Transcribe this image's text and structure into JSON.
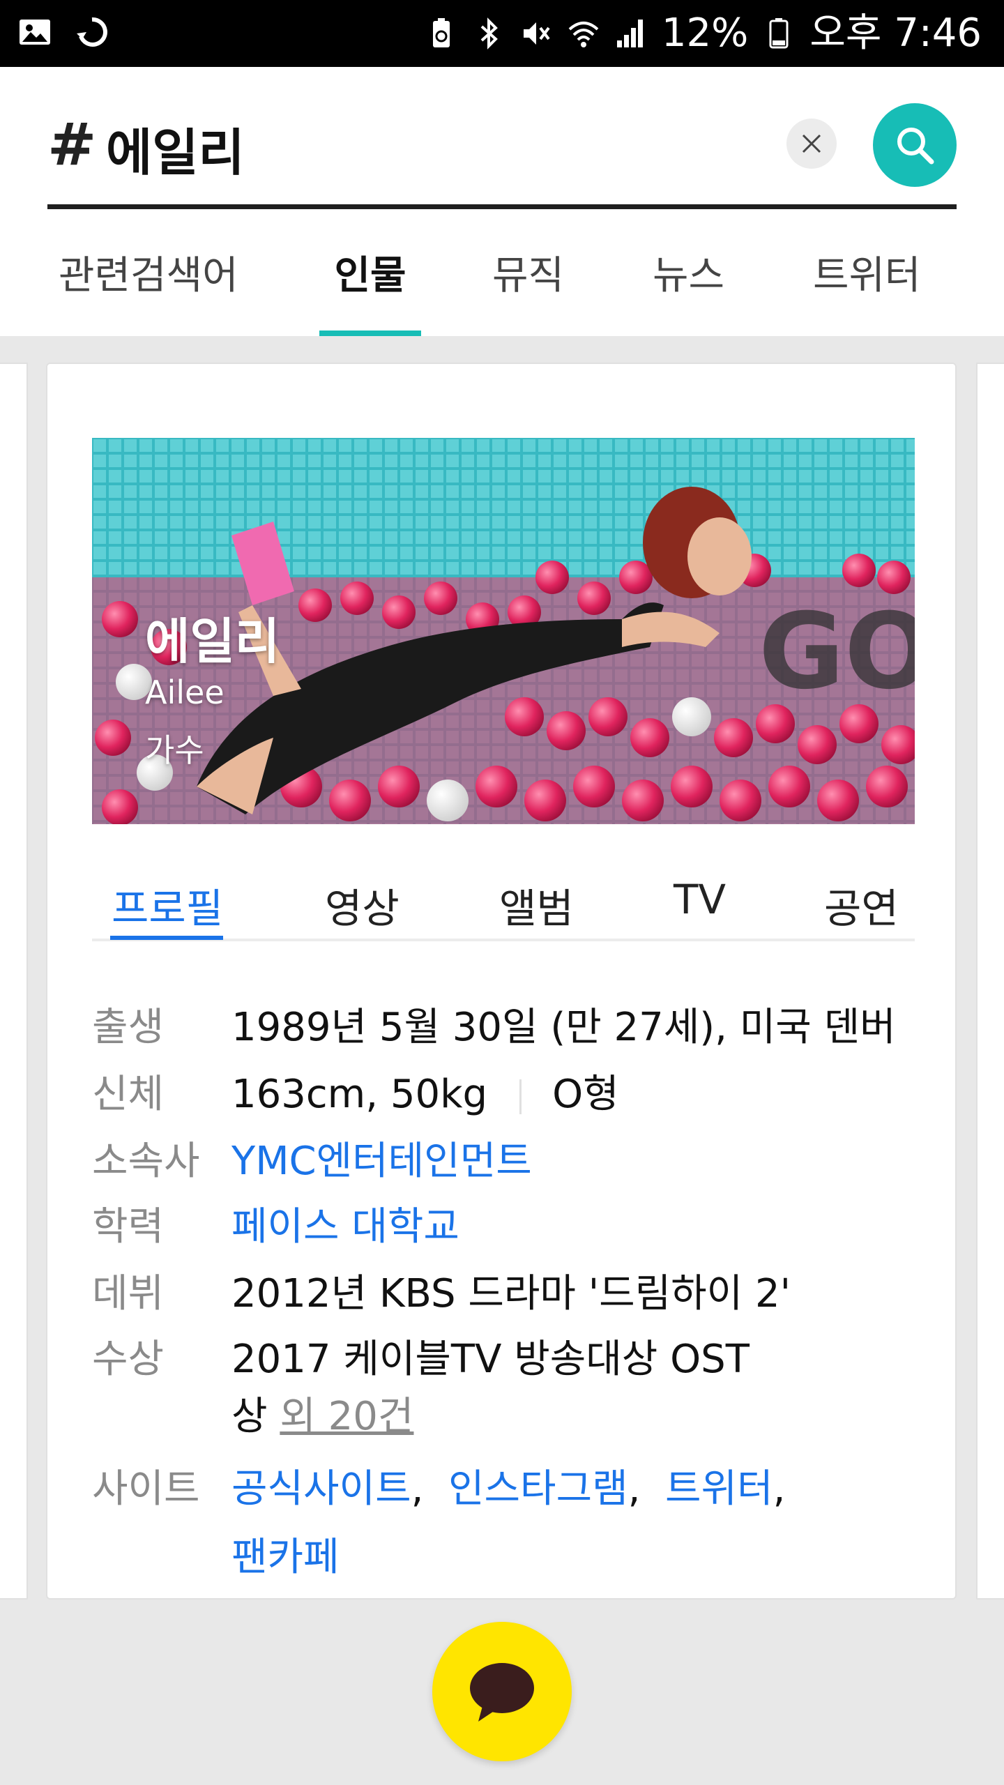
{
  "status_bar": {
    "left_icons": [
      "gallery-icon",
      "sync-icon"
    ],
    "right_icons": [
      "battery-saver-icon",
      "bluetooth-icon",
      "mute-icon",
      "wifi-icon",
      "signal-icon"
    ],
    "battery": "12%",
    "time": "오후 7:46"
  },
  "search": {
    "hash": "#",
    "query": "에일리"
  },
  "tabs": [
    {
      "label": "관련검색어"
    },
    {
      "label": "인물"
    },
    {
      "label": "뮤직"
    },
    {
      "label": "뉴스"
    },
    {
      "label": "트위터"
    }
  ],
  "active_tab": "인물",
  "hero": {
    "name": "에일리",
    "name_en": "Ailee",
    "job": "가수",
    "watermark": "GO!"
  },
  "subtabs": [
    {
      "label": "프로필"
    },
    {
      "label": "영상"
    },
    {
      "label": "앨범"
    },
    {
      "label": "TV"
    },
    {
      "label": "공연"
    }
  ],
  "active_subtab": "프로필",
  "profile": {
    "birth": {
      "label": "출생",
      "value": "1989년 5월 30일 (만 27세), 미국 덴버"
    },
    "body": {
      "label": "신체",
      "value": "163cm, 50kg",
      "blood": "O형"
    },
    "agency": {
      "label": "소속사",
      "value": "YMC엔터테인먼트"
    },
    "education": {
      "label": "학력",
      "value": "페이스 대학교"
    },
    "debut": {
      "label": "데뷔",
      "value": "2012년 KBS 드라마 '드림하이 2'"
    },
    "award": {
      "label": "수상",
      "value_line1": "2017 케이블TV 방송대상 OST",
      "value_line2": "상",
      "more": "외 20건"
    },
    "site": {
      "label": "사이트",
      "links": [
        "공식사이트",
        "인스타그램",
        "트위터",
        "팬카페"
      ]
    }
  },
  "colors": {
    "accent_teal": "#17bdb6",
    "link_blue": "#1a73e8",
    "fab_yellow": "#ffe500"
  }
}
